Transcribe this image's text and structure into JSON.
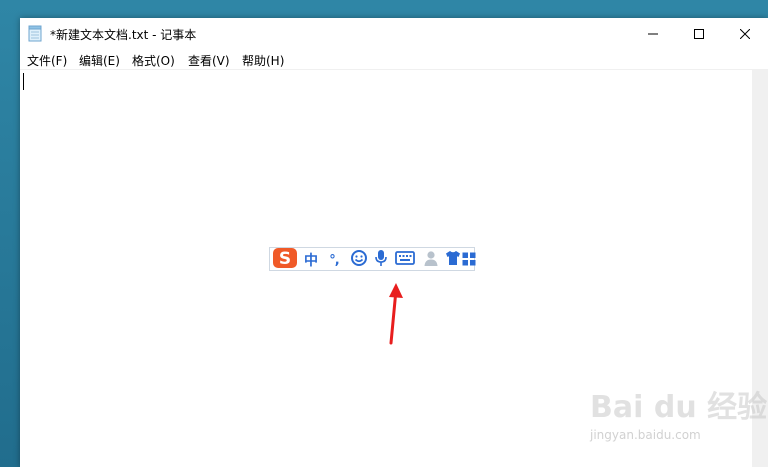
{
  "window": {
    "title": "*新建文本文档.txt - 记事本",
    "controls": {
      "minimize_icon": "minimize-icon",
      "maximize_icon": "maximize-icon",
      "close_icon": "close-icon"
    }
  },
  "menu": {
    "items": [
      {
        "label": "文件(F)"
      },
      {
        "label": "编辑(E)"
      },
      {
        "label": "格式(O)"
      },
      {
        "label": "查看(V)"
      },
      {
        "label": "帮助(H)"
      }
    ]
  },
  "editor": {
    "text": ""
  },
  "ime_toolbar": {
    "logo_icon": "sogou-logo-icon",
    "language_mode": "中",
    "punctuation_mode": "°,",
    "icons": [
      "emoji-icon",
      "microphone-icon",
      "keyboard-icon",
      "user-icon",
      "skin-shirt-icon",
      "toolbox-icon"
    ],
    "colors": {
      "accent": "#2b6bd3",
      "logo": "#f05a28"
    }
  },
  "annotation": {
    "arrow_color": "#e81e1e"
  },
  "watermark": {
    "logo_text": "Bai du 经验",
    "url": "jingyan.baidu.com"
  }
}
